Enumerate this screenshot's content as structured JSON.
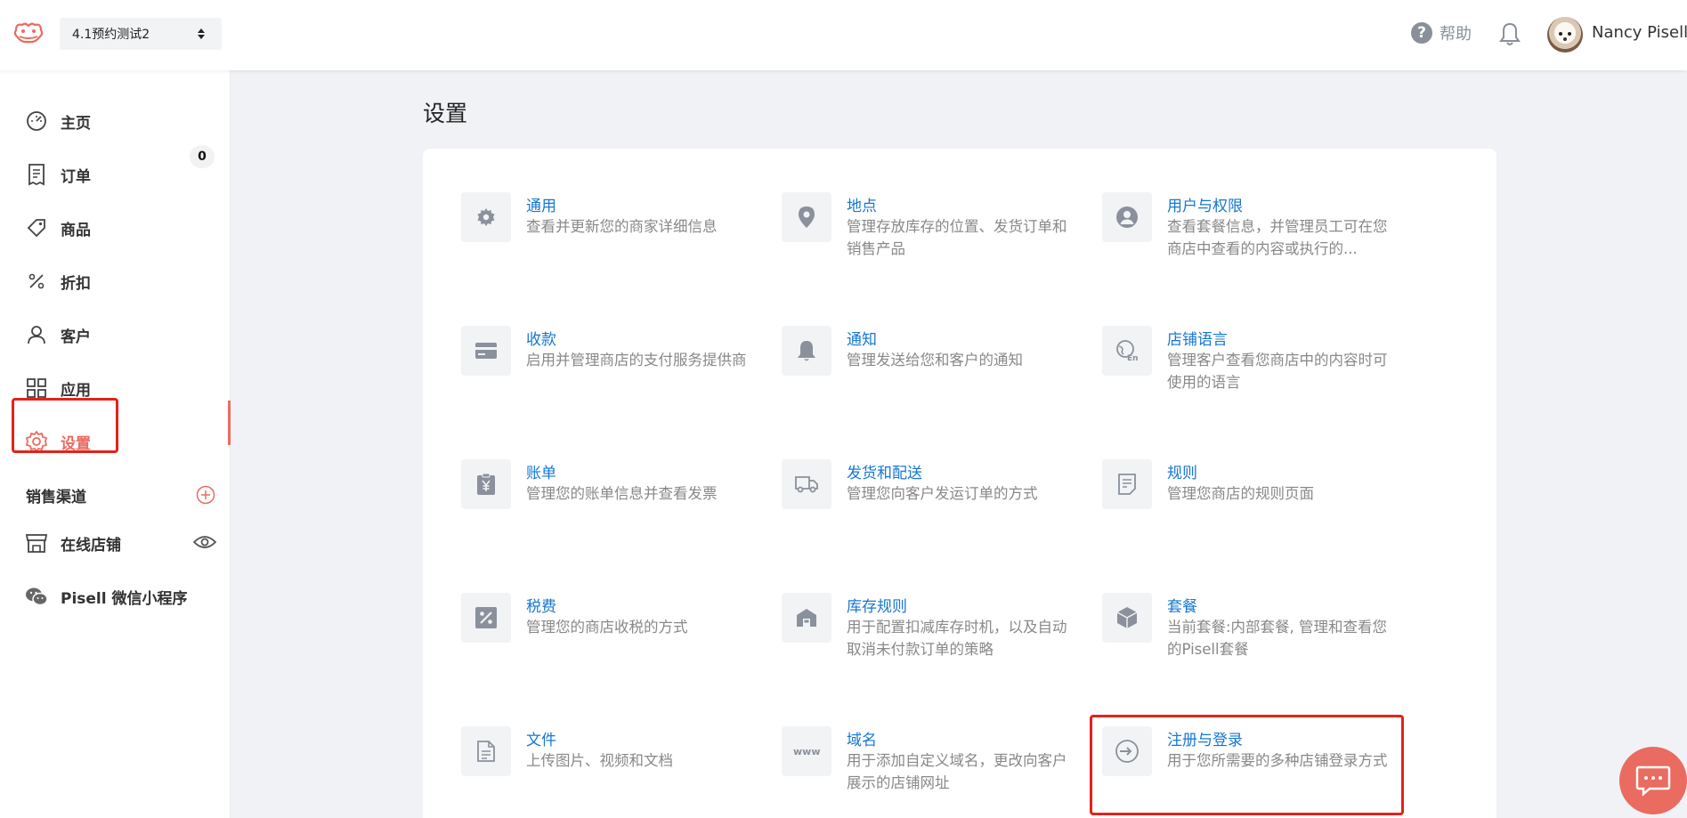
{
  "header": {
    "store_name": "4.1预约测试2",
    "help_label": "帮助",
    "username": "Nancy Pisell"
  },
  "sidebar": {
    "items": [
      {
        "label": "主页",
        "icon": "dashboard-icon"
      },
      {
        "label": "订单",
        "icon": "order-icon",
        "badge": "0"
      },
      {
        "label": "商品",
        "icon": "tag-icon"
      },
      {
        "label": "折扣",
        "icon": "percent-icon"
      },
      {
        "label": "客户",
        "icon": "user-icon"
      },
      {
        "label": "应用",
        "icon": "apps-icon"
      },
      {
        "label": "设置",
        "icon": "gear-icon",
        "active": true
      }
    ],
    "sales_channels_title": "销售渠道",
    "channels": [
      {
        "label": "在线店铺",
        "icon": "store-icon"
      },
      {
        "label": "Pisell 微信小程序",
        "icon": "wechat-icon"
      }
    ]
  },
  "page": {
    "title": "设置"
  },
  "settings": [
    {
      "title": "通用",
      "desc": "查看并更新您的商家详细信息",
      "icon": "gear-icon"
    },
    {
      "title": "地点",
      "desc": "管理存放库存的位置、发货订单和销售产品",
      "icon": "location-pin-icon"
    },
    {
      "title": "用户与权限",
      "desc": "查看套餐信息，并管理员工可在您商店中查看的内容或执行的...",
      "icon": "user-circle-icon"
    },
    {
      "title": "收款",
      "desc": "启用并管理商店的支付服务提供商",
      "icon": "credit-card-icon"
    },
    {
      "title": "通知",
      "desc": "管理发送给您和客户的通知",
      "icon": "bell-icon"
    },
    {
      "title": "店铺语言",
      "desc": "管理客户查看您商店中的内容时可使用的语言",
      "icon": "language-icon"
    },
    {
      "title": "账单",
      "desc": "管理您的账单信息并查看发票",
      "icon": "invoice-yen-icon"
    },
    {
      "title": "发货和配送",
      "desc": "管理您向客户发运订单的方式",
      "icon": "truck-icon"
    },
    {
      "title": "规则",
      "desc": "管理您商店的规则页面",
      "icon": "document-rules-icon"
    },
    {
      "title": "税费",
      "desc": "管理您的商店收税的方式",
      "icon": "percent-box-icon"
    },
    {
      "title": "库存规则",
      "desc": "用于配置扣减库存时机，以及自动取消未付款订单的策略",
      "icon": "warehouse-icon"
    },
    {
      "title": "套餐",
      "desc": "当前套餐:内部套餐, 管理和查看您的Pisell套餐",
      "icon": "package-box-icon"
    },
    {
      "title": "文件",
      "desc": "上传图片、视频和文档",
      "icon": "file-icon"
    },
    {
      "title": "域名",
      "desc": "用于添加自定义域名，更改向客户展示的店铺网址",
      "icon": "www-icon"
    },
    {
      "title": "注册与登录",
      "desc": "用于您所需要的多种店铺登录方式",
      "icon": "login-icon"
    }
  ]
}
